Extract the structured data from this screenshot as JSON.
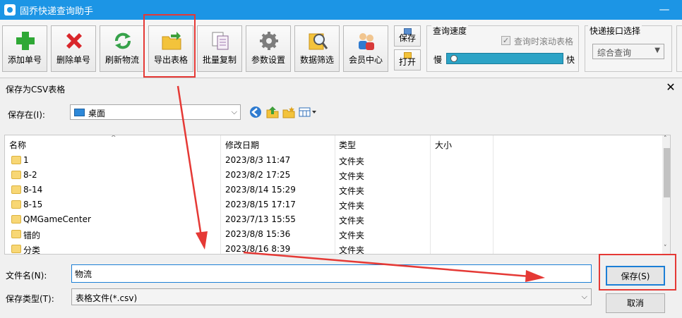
{
  "app": {
    "title": "固乔快递查询助手",
    "minimize_glyph": "—"
  },
  "toolbar": {
    "buttons": [
      {
        "label": "添加单号",
        "icon": "add-icon"
      },
      {
        "label": "删除单号",
        "icon": "delete-icon"
      },
      {
        "label": "刷新物流",
        "icon": "refresh-icon"
      },
      {
        "label": "导出表格",
        "icon": "export-folder-icon"
      },
      {
        "label": "批量复制",
        "icon": "copy-icon"
      },
      {
        "label": "参数设置",
        "icon": "gear-icon"
      },
      {
        "label": "数据筛选",
        "icon": "filter-search-icon"
      },
      {
        "label": "会员中心",
        "icon": "users-icon"
      }
    ],
    "save_label": "保存",
    "open_label": "打开",
    "speed_group": {
      "title": "查询速度",
      "scroll_checkbox_label": "查询时滚动表格",
      "scroll_checked": true,
      "slow_label": "慢",
      "fast_label": "快",
      "speed_level": 0.02
    },
    "api_group": {
      "title": "快递接口选择",
      "selected": "综合查询"
    }
  },
  "dialog": {
    "title": "保存为CSV表格",
    "close_glyph": "✕",
    "save_in_label": "保存在(I):",
    "save_in_value": "桌面",
    "columns": [
      "名称",
      "修改日期",
      "类型",
      "大小"
    ],
    "files": [
      {
        "name": "1",
        "date": "2023/8/3 11:47",
        "type": "文件夹"
      },
      {
        "name": "8-2",
        "date": "2023/8/2 17:25",
        "type": "文件夹"
      },
      {
        "name": "8-14",
        "date": "2023/8/14 15:29",
        "type": "文件夹"
      },
      {
        "name": "8-15",
        "date": "2023/8/15 17:17",
        "type": "文件夹"
      },
      {
        "name": "QMGameCenter",
        "date": "2023/7/13 15:55",
        "type": "文件夹"
      },
      {
        "name": "错的",
        "date": "2023/8/8 15:36",
        "type": "文件夹"
      },
      {
        "name": "分类",
        "date": "2023/8/16 8:39",
        "type": "文件夹"
      }
    ],
    "filename_label": "文件名(N):",
    "filename_value": "物流",
    "filetype_label": "保存类型(T):",
    "filetype_value": "表格文件(*.csv)",
    "save_button": "保存(S)",
    "cancel_button": "取消"
  }
}
